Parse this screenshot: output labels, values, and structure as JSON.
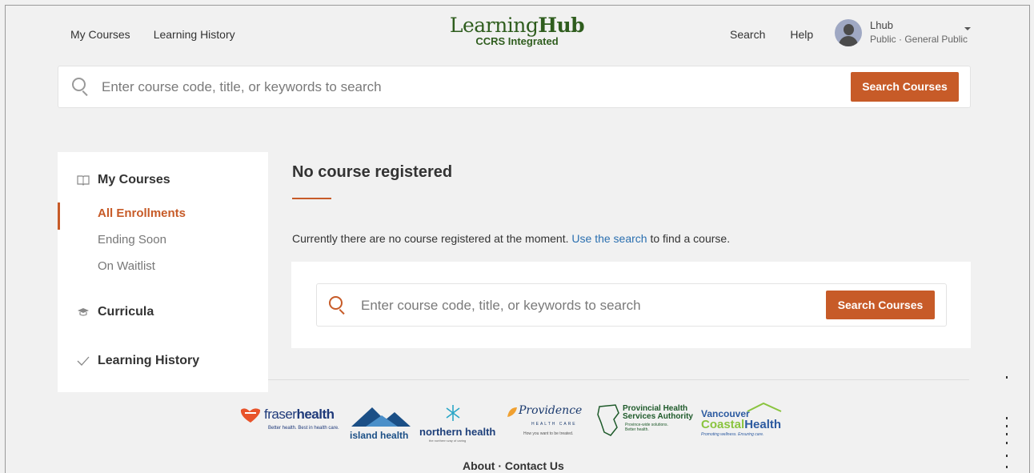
{
  "header": {
    "nav_left": [
      "My Courses",
      "Learning History"
    ],
    "logo": {
      "main_light": "Learning",
      "main_bold": "Hub",
      "sub": "CCRS Integrated"
    },
    "nav_right": [
      "Search",
      "Help"
    ],
    "user": {
      "name": "Lhub",
      "role": "Public · General Public"
    }
  },
  "top_search": {
    "placeholder": "Enter course code, title, or keywords to search",
    "button": "Search Courses"
  },
  "sidebar": {
    "my_courses": {
      "title": "My Courses",
      "items": [
        {
          "label": "All Enrollments",
          "active": true
        },
        {
          "label": "Ending Soon",
          "active": false
        },
        {
          "label": "On Waitlist",
          "active": false
        }
      ]
    },
    "curricula": "Curricula",
    "learning_history": "Learning History"
  },
  "main": {
    "title": "No course registered",
    "message_before": "Currently there are no course registered at the moment.",
    "message_link": "Use the search",
    "message_after": "to find a course.",
    "search": {
      "placeholder": "Enter course code, title, or keywords to search",
      "button": "Search Courses"
    }
  },
  "partners": {
    "fraser": {
      "name_bold": "fraser",
      "name_light": "health",
      "tagline": "Better health. Best in health care."
    },
    "island": {
      "name": "island health"
    },
    "northern": {
      "name": "northern health",
      "tagline": "the northern way of caring"
    },
    "providence": {
      "name": "Providence",
      "sub": "HEALTH CARE",
      "tagline": "How you want to be treated."
    },
    "phsa": {
      "name_line1": "Provincial Health",
      "name_line2": "Services Authority",
      "tagline_line1": "Province-wide solutions.",
      "tagline_line2": "Better health."
    },
    "vch": {
      "line1": "Vancouver",
      "line2_a": "Coastal",
      "line2_b": "Health",
      "tagline": "Promoting wellness. Ensuring care."
    }
  },
  "footer": {
    "about": "About",
    "separator": "·",
    "contact": "Contact Us"
  },
  "colors": {
    "accent": "#c75b28",
    "brand_green": "#2f5d1e",
    "link": "#2a6fb0",
    "background": "#f1f1f1"
  }
}
